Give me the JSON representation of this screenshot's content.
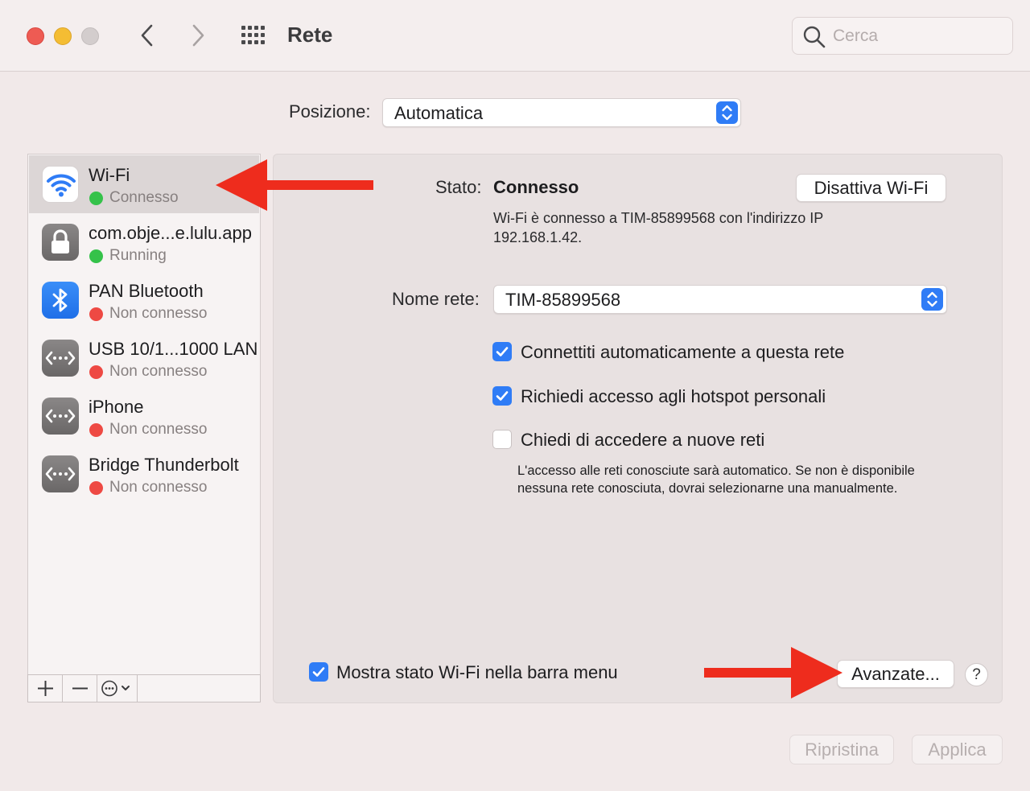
{
  "window": {
    "title": "Rete",
    "search_placeholder": "Cerca"
  },
  "location": {
    "label": "Posizione:",
    "value": "Automatica"
  },
  "services": [
    {
      "name": "Wi-Fi",
      "status": "Connesso",
      "status_color": "#35c24a",
      "icon": "wifi-icon",
      "selected": true
    },
    {
      "name": "com.obje...e.lulu.app",
      "status": "Running",
      "status_color": "#35c24a",
      "icon": "lock-icon",
      "selected": false
    },
    {
      "name": "PAN Bluetooth",
      "status": "Non connesso",
      "status_color": "#ee4943",
      "icon": "bluetooth-icon",
      "selected": false
    },
    {
      "name": "USB 10/1...1000 LAN",
      "status": "Non connesso",
      "status_color": "#ee4943",
      "icon": "ethernet-icon",
      "selected": false
    },
    {
      "name": "iPhone",
      "status": "Non connesso",
      "status_color": "#ee4943",
      "icon": "ethernet-icon",
      "selected": false
    },
    {
      "name": "Bridge Thunderbolt",
      "status": "Non connesso",
      "status_color": "#ee4943",
      "icon": "ethernet-icon",
      "selected": false
    }
  ],
  "detail": {
    "status_label": "Stato:",
    "status_value": "Connesso",
    "status_description": "Wi-Fi è connesso a TIM-85899568 con l'indirizzo IP 192.168.1.42.",
    "wifi_off_button": "Disattiva Wi-Fi",
    "network_name_label": "Nome rete:",
    "network_name_value": "TIM-85899568",
    "checkboxes": [
      {
        "label": "Connettiti automaticamente a questa rete",
        "checked": true
      },
      {
        "label": "Richiedi accesso agli hotspot personali",
        "checked": true
      },
      {
        "label": "Chiedi di accedere a nuove reti",
        "checked": false
      }
    ],
    "note": "L'accesso alle reti conosciute sarà automatico. Se non è disponibile nessuna rete conosciuta, dovrai selezionarne una manualmente.",
    "menu_bar_checkbox": {
      "label": "Mostra stato Wi-Fi nella barra menu",
      "checked": true
    },
    "advanced_button": "Avanzate...",
    "help_button": "?"
  },
  "footer": {
    "revert_button": "Ripristina",
    "apply_button": "Applica"
  },
  "colors": {
    "accent": "#2f7cf6",
    "annotation_arrow": "#ee2c1d",
    "connected": "#35c24a",
    "disconnected": "#ee4943"
  }
}
